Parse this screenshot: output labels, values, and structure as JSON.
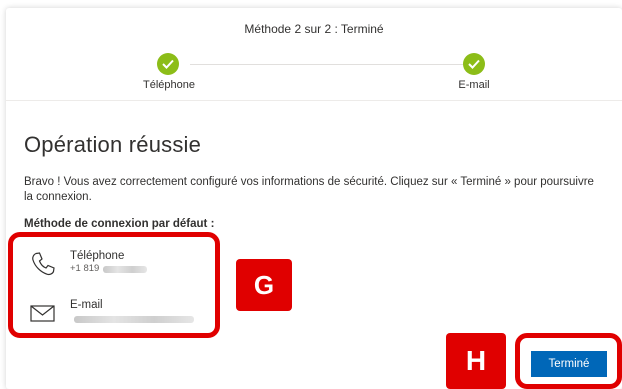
{
  "header": {
    "step_title": "Méthode 2 sur 2 : Terminé",
    "steps": [
      {
        "label": "Téléphone"
      },
      {
        "label": "E-mail"
      }
    ]
  },
  "main": {
    "heading": "Opération réussie",
    "description": "Bravo ! Vous avez correctement configuré vos informations de sécurité. Cliquez sur « Terminé » pour poursuivre la connexion.",
    "default_method_title": "Méthode de connexion par défaut :",
    "methods": [
      {
        "name": "Téléphone",
        "value": "+1 819",
        "icon": "phone-icon"
      },
      {
        "name": "E-mail",
        "value": "",
        "icon": "mail-icon"
      }
    ]
  },
  "annotations": {
    "g_label": "G",
    "h_label": "H",
    "color": "#e00000"
  },
  "actions": {
    "done_label": "Terminé"
  },
  "colors": {
    "check_green": "#8cbd18",
    "primary_blue": "#0067b8"
  }
}
